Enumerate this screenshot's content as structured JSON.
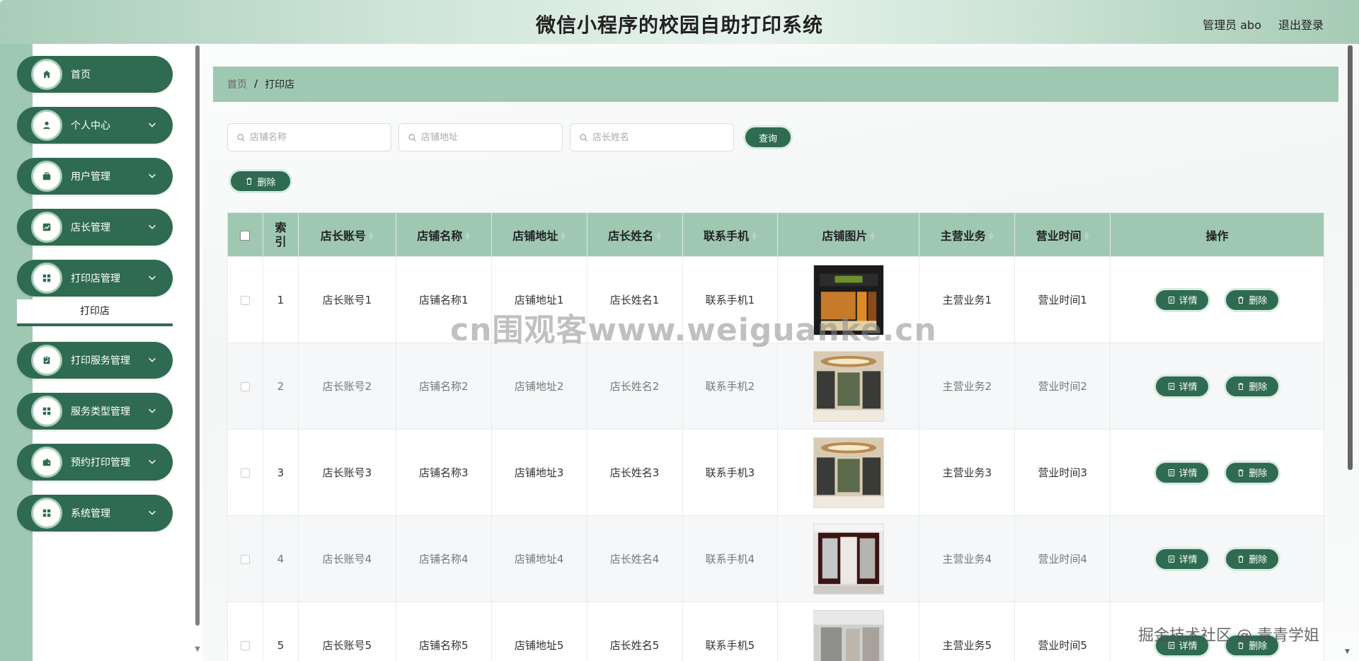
{
  "header": {
    "title": "微信小程序的校园自助打印系统",
    "user_label": "管理员 abo",
    "logout_label": "退出登录"
  },
  "sidebar": {
    "items": [
      {
        "label": "首页",
        "icon": "home-icon",
        "has_chevron": false
      },
      {
        "label": "个人中心",
        "icon": "user-icon",
        "has_chevron": true
      },
      {
        "label": "用户管理",
        "icon": "briefcase-icon",
        "has_chevron": true
      },
      {
        "label": "店长管理",
        "icon": "chart-icon",
        "has_chevron": true
      },
      {
        "label": "打印店管理",
        "icon": "grid-icon",
        "has_chevron": true
      },
      {
        "label": "打印服务管理",
        "icon": "clipboard-icon",
        "has_chevron": true
      },
      {
        "label": "服务类型管理",
        "icon": "grid-icon",
        "has_chevron": true
      },
      {
        "label": "预约打印管理",
        "icon": "wallet-icon",
        "has_chevron": true
      },
      {
        "label": "系统管理",
        "icon": "grid-icon",
        "has_chevron": true
      }
    ],
    "active_sub_item": "打印店"
  },
  "breadcrumb": {
    "home": "首页",
    "separator": "/",
    "current": "打印店"
  },
  "search": {
    "shop_name_placeholder": "店铺名称",
    "shop_address_placeholder": "店铺地址",
    "manager_name_placeholder": "店长姓名",
    "query_label": "查询"
  },
  "toolbar": {
    "delete_label": "删除"
  },
  "table": {
    "columns": [
      "索引",
      "店长账号",
      "店铺名称",
      "店铺地址",
      "店长姓名",
      "联系手机",
      "店铺图片",
      "主营业务",
      "营业时间",
      "操作"
    ],
    "rows": [
      {
        "index": "1",
        "account": "店长账号1",
        "name": "店铺名称1",
        "address": "店铺地址1",
        "manager": "店长姓名1",
        "phone": "联系手机1",
        "business": "主营业务1",
        "hours": "营业时间1"
      },
      {
        "index": "2",
        "account": "店长账号2",
        "name": "店铺名称2",
        "address": "店铺地址2",
        "manager": "店长姓名2",
        "phone": "联系手机2",
        "business": "主营业务2",
        "hours": "营业时间2"
      },
      {
        "index": "3",
        "account": "店长账号3",
        "name": "店铺名称3",
        "address": "店铺地址3",
        "manager": "店长姓名3",
        "phone": "联系手机3",
        "business": "主营业务3",
        "hours": "营业时间3"
      },
      {
        "index": "4",
        "account": "店长账号4",
        "name": "店铺名称4",
        "address": "店铺地址4",
        "manager": "店长姓名4",
        "phone": "联系手机4",
        "business": "主营业务4",
        "hours": "营业时间4"
      },
      {
        "index": "5",
        "account": "店长账号5",
        "name": "店铺名称5",
        "address": "店铺地址5",
        "manager": "店长姓名5",
        "phone": "联系手机5",
        "business": "主营业务5",
        "hours": "营业时间5"
      }
    ],
    "detail_label": "详情",
    "delete_label": "删除"
  },
  "overlay": {
    "watermark": "cn围观客www.weiguanke.cn",
    "attribution": "掘金技术社区 @ 青青学姐"
  },
  "colors": {
    "primary": "#2f6b52",
    "accent_light": "#9fc8b3",
    "header_gradient_mid": "#e8f3ed"
  }
}
